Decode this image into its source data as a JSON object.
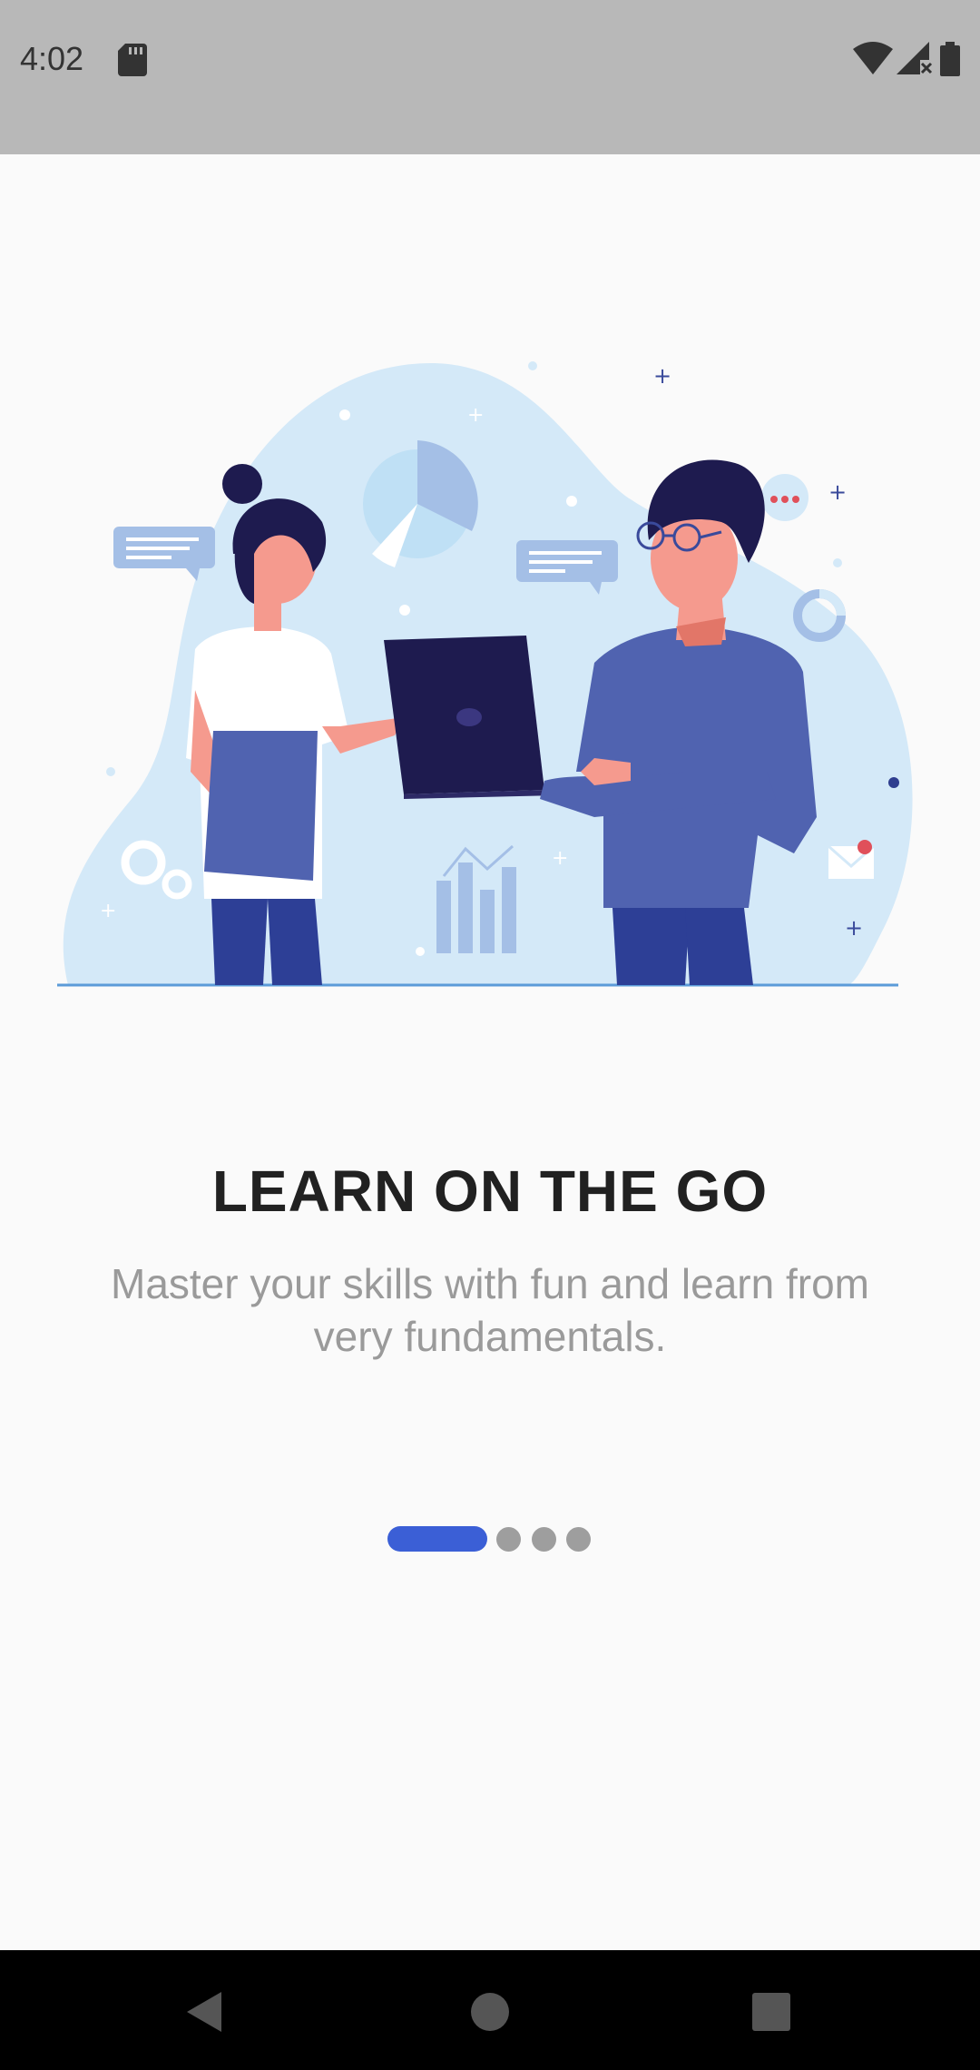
{
  "status_bar": {
    "time": "4:02",
    "icons": [
      "sd-card-icon",
      "wifi-icon",
      "signal-icon",
      "battery-icon"
    ]
  },
  "illustration": {
    "description_icon": "people-with-laptop-illustration"
  },
  "onboarding": {
    "title": "LEARN ON THE GO",
    "subtitle": "Master your skills with fun and learn from very fundamentals.",
    "page_index": 1,
    "page_count": 4
  },
  "nav_bar": {
    "icons": [
      "back-icon",
      "home-icon",
      "recents-icon"
    ]
  },
  "colors": {
    "accent": "#3b5fd6",
    "inactive_dot": "#9e9e9e",
    "status_bar": "#b8b8b8",
    "title": "#212121",
    "subtitle": "#9a9a9a"
  }
}
